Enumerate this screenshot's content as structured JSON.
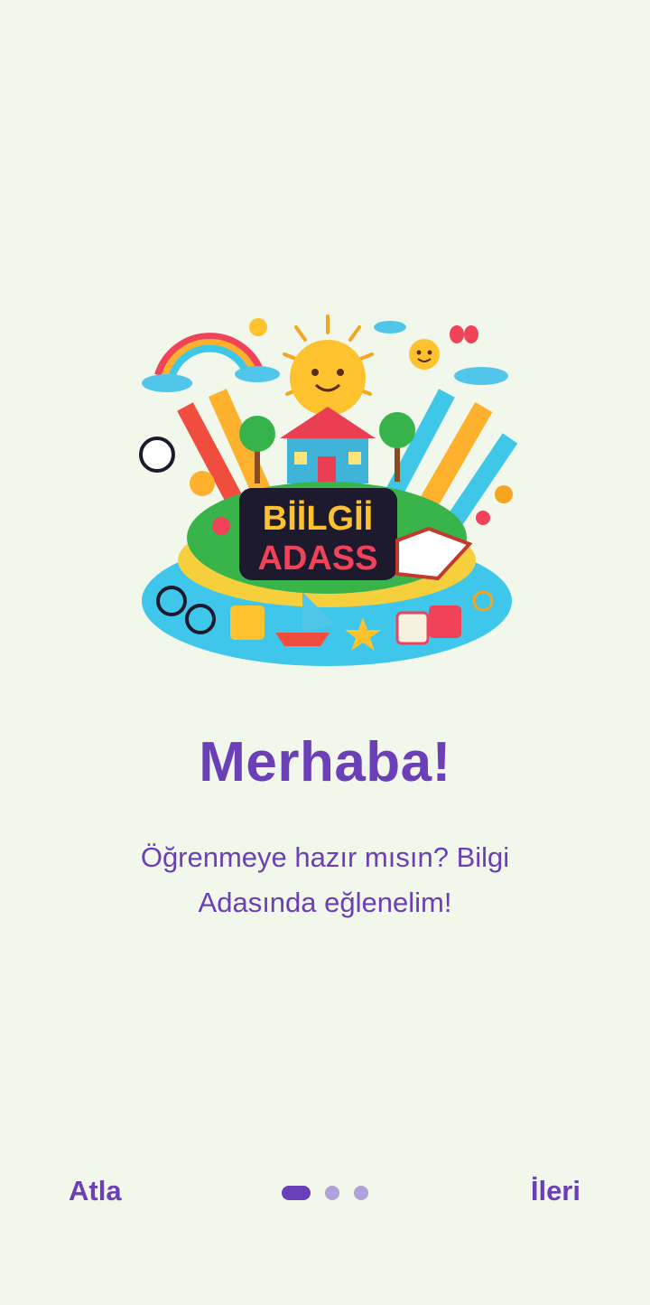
{
  "illustration": {
    "logo_text_line1": "BİİLGİİ",
    "logo_text_line2": "ADASS"
  },
  "onboarding": {
    "title": "Merhaba!",
    "subtitle": "Öğrenmeye hazır mısın? Bilgi Adasında eğlenelim!"
  },
  "pagination": {
    "total_pages": 3,
    "current_page": 1
  },
  "nav": {
    "skip_label": "Atla",
    "next_label": "İleri"
  },
  "colors": {
    "accent": "#6a3fb7",
    "inactive_dot": "#b1a1d8",
    "background": "#f1f7ea"
  }
}
